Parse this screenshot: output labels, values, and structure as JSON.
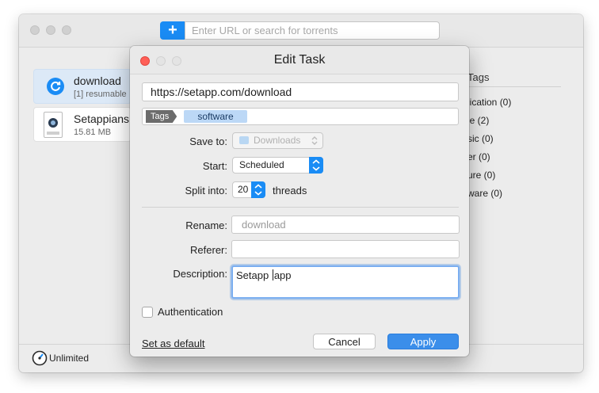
{
  "main": {
    "url_placeholder": "Enter URL or search for torrents",
    "add_icon": "+",
    "downloads": [
      {
        "title": "download",
        "subtitle": "[1] resumable",
        "icon": "refresh-icon",
        "selected": true
      },
      {
        "title": "Setappians",
        "subtitle": "15.81 MB",
        "icon": "quicktime-file-icon",
        "selected": false
      }
    ],
    "tags_panel": {
      "header": "Tags",
      "rows": [
        "lication (0)",
        "ie (2)",
        "sic (0)",
        "er (0)",
        "ure (0)",
        "ware (0)"
      ]
    },
    "status": {
      "speed_label": "Unlimited",
      "speed_icon": "speedometer-icon"
    }
  },
  "dialog": {
    "title": "Edit Task",
    "url": "https://setapp.com/download",
    "tags_label": "Tags",
    "tags": [
      "software"
    ],
    "save_to": {
      "label": "Save to:",
      "value": "Downloads"
    },
    "start": {
      "label": "Start:",
      "value": "Scheduled"
    },
    "split": {
      "label": "Split into:",
      "value": "20",
      "unit": "threads"
    },
    "rename": {
      "label": "Rename:",
      "placeholder": "download"
    },
    "referer": {
      "label": "Referer:",
      "value": ""
    },
    "description": {
      "label": "Description:",
      "before_caret": "Setapp ",
      "after_caret": "app"
    },
    "authentication": {
      "label": "Authentication",
      "checked": false
    },
    "set_default": "Set as default",
    "cancel": "Cancel",
    "apply": "Apply"
  },
  "colors": {
    "accent": "#1a8cf5",
    "close_red": "#ff5f57",
    "tag_chip": "#bcd8f6"
  }
}
